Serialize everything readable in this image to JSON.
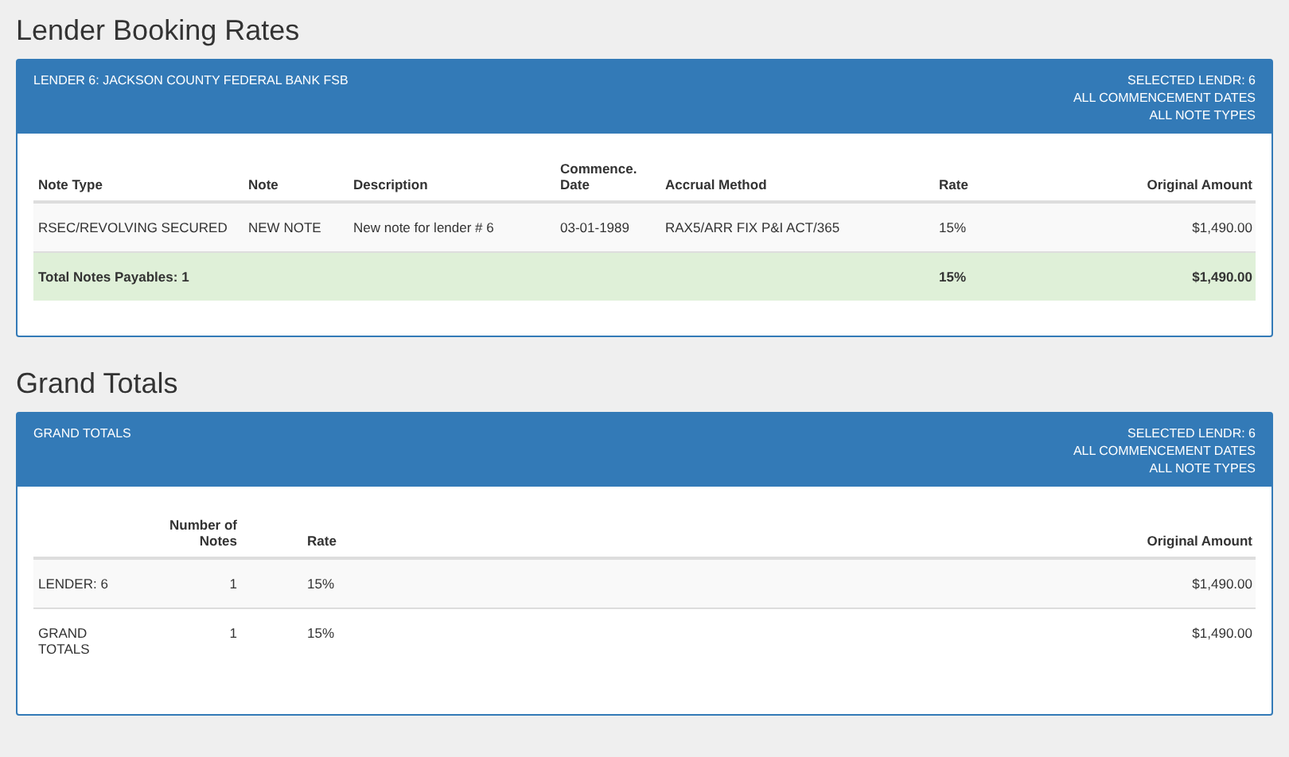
{
  "sections": [
    {
      "title": "Lender Booking Rates",
      "panel": {
        "heading": "LENDER  6:  JACKSON COUNTY FEDERAL BANK FSB",
        "filters": [
          "SELECTED LENDR: 6",
          "ALL COMMENCEMENT DATES",
          "ALL NOTE TYPES"
        ]
      },
      "table": {
        "columns": [
          {
            "label": "Note Type"
          },
          {
            "label": "Note"
          },
          {
            "label": "Description"
          },
          {
            "label": "Commence.\nDate"
          },
          {
            "label": "Accrual Method"
          },
          {
            "label": "Rate"
          },
          {
            "label": "Original Amount"
          }
        ],
        "rows": [
          {
            "kind": "striped",
            "cells": [
              "RSEC/REVOLVING SECURED",
              "NEW NOTE",
              "New note for lender # 6",
              "03-01-1989",
              "RAX5/ARR FIX P&I ACT/365",
              "15%",
              "$1,490.00"
            ]
          },
          {
            "kind": "total",
            "cells": [
              {
                "text": "Total Notes Payables: 1",
                "colspan": 5
              },
              "15%",
              "$1,490.00"
            ]
          }
        ]
      }
    },
    {
      "title": "Grand Totals",
      "panel": {
        "heading": "GRAND TOTALS",
        "filters": [
          "SELECTED LENDR: 6",
          "ALL COMMENCEMENT DATES",
          "ALL NOTE TYPES"
        ]
      },
      "table": {
        "columns": [
          {},
          {
            "label": "Number of\nNotes"
          },
          {
            "label": "Rate"
          },
          {
            "label": "Original Amount"
          }
        ],
        "rows": [
          {
            "kind": "striped",
            "cells": [
              "LENDER: 6",
              "1",
              "15%",
              "$1,490.00"
            ]
          },
          {
            "kind": "plain",
            "cells": [
              "GRAND\nTOTALS",
              "1",
              "15%",
              "$1,490.00"
            ]
          }
        ]
      }
    }
  ]
}
